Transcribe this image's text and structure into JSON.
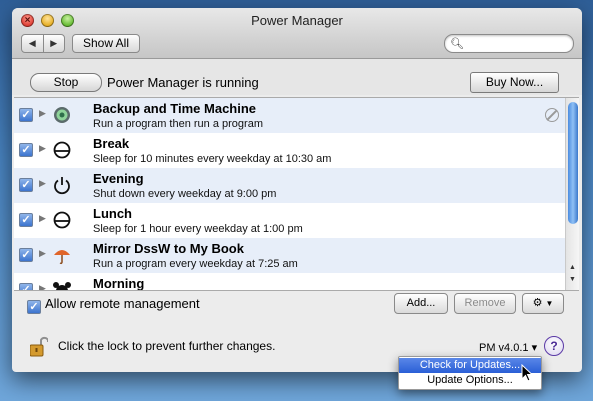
{
  "window": {
    "title": "Power Manager"
  },
  "toolbar": {
    "back_label": "◀",
    "forward_label": "▶",
    "show_all_label": "Show All",
    "search_placeholder": ""
  },
  "status": {
    "stop_label": "Stop",
    "running_text": "Power Manager is running",
    "buy_now_label": "Buy Now..."
  },
  "events": [
    {
      "icon": "backup-icon",
      "title": "Backup and Time Machine",
      "subtitle": "Run a program then run a program",
      "checked": true,
      "alt": true,
      "disabled_marker": true
    },
    {
      "icon": "sleep-icon",
      "title": "Break",
      "subtitle": "Sleep for 10 minutes every weekday at 10:30 am",
      "checked": true,
      "alt": false
    },
    {
      "icon": "power-icon",
      "title": "Evening",
      "subtitle": "Shut down every weekday at 9:00 pm",
      "checked": true,
      "alt": true
    },
    {
      "icon": "sleep-icon",
      "title": "Lunch",
      "subtitle": "Sleep for 1 hour every weekday at 1:00 pm",
      "checked": true,
      "alt": false
    },
    {
      "icon": "umbrella-icon",
      "title": "Mirror DssW to My Book",
      "subtitle": "Run a program every weekday at 7:25 am",
      "checked": true,
      "alt": true
    },
    {
      "icon": "alarm-icon",
      "title": "Morning",
      "subtitle": "",
      "checked": true,
      "alt": false
    }
  ],
  "bottom": {
    "allow_remote_label": "Allow remote management",
    "add_label": "Add...",
    "remove_label": "Remove",
    "lock_text": "Click the lock to prevent further changes.",
    "version_label": "PM v4.0.1 ▾",
    "help_label": "?"
  },
  "version_menu": {
    "items": [
      "Check for Updates...",
      "Update Options..."
    ]
  },
  "colors": {
    "selection": "#2a5fd6",
    "alt_row": "#e7eef9"
  }
}
